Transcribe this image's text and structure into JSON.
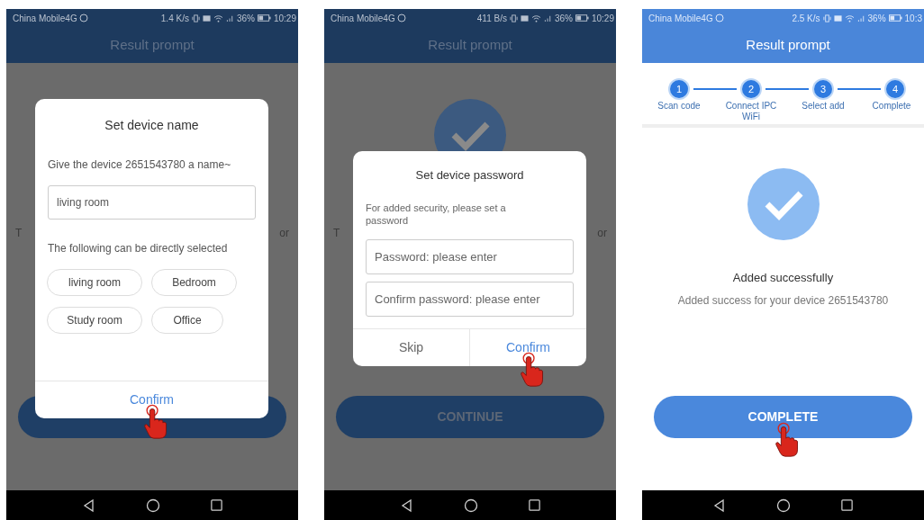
{
  "phones": [
    {
      "dimmed": true,
      "status_bar": {
        "carrier": "China Mobile4G",
        "speed": "1.4 K/s",
        "battery": "36%",
        "time": "10:29"
      },
      "title": "Result prompt",
      "background": {
        "text_left": "T",
        "text_right": "or",
        "button": {
          "tapped": false
        }
      },
      "dialog": {
        "kind": "name",
        "title": "Set device name",
        "prompt": "Give the device 2651543780 a name~",
        "value": "living room",
        "hint": "The following can be directly selected",
        "options": [
          "living room",
          "Bedroom",
          "Study room",
          "Office"
        ],
        "actions": [
          {
            "kind": "primary",
            "label": "Confirm",
            "tapped": true
          }
        ]
      }
    },
    {
      "dimmed": true,
      "status_bar": {
        "carrier": "China Mobile4G",
        "speed": "411 B/s",
        "battery": "36%",
        "time": "10:29"
      },
      "title": "Result prompt",
      "background": {
        "check_mark": true,
        "text_left": "T",
        "text_right": "or",
        "button": {
          "label": "CONTINUE",
          "tapped": false
        }
      },
      "dialog": {
        "kind": "password",
        "title": "Set device password",
        "prompt": "For added security, please set a password",
        "fields": [
          {
            "placeholder": "Password: please enter"
          },
          {
            "placeholder": "Confirm password: please enter"
          }
        ],
        "actions": [
          {
            "kind": "cancel",
            "label": "Skip",
            "tapped": false
          },
          {
            "kind": "primary",
            "label": "Confirm",
            "tapped": true
          }
        ]
      }
    },
    {
      "dimmed": false,
      "status_bar": {
        "carrier": "China Mobile4G",
        "speed": "2.5 K/s",
        "battery": "36%",
        "time": "10:3"
      },
      "title": "Result prompt",
      "steps": [
        {
          "number": "1",
          "label": "Scan code"
        },
        {
          "number": "2",
          "label": "Connect IPC WiFi"
        },
        {
          "number": "3",
          "label": "Select add"
        },
        {
          "number": "4",
          "label": "Complete"
        }
      ],
      "result": {
        "heading": "Added successfully",
        "detail": "Added success for your device 2651543780"
      },
      "button": {
        "label": "COMPLETE",
        "tapped": true
      }
    }
  ]
}
